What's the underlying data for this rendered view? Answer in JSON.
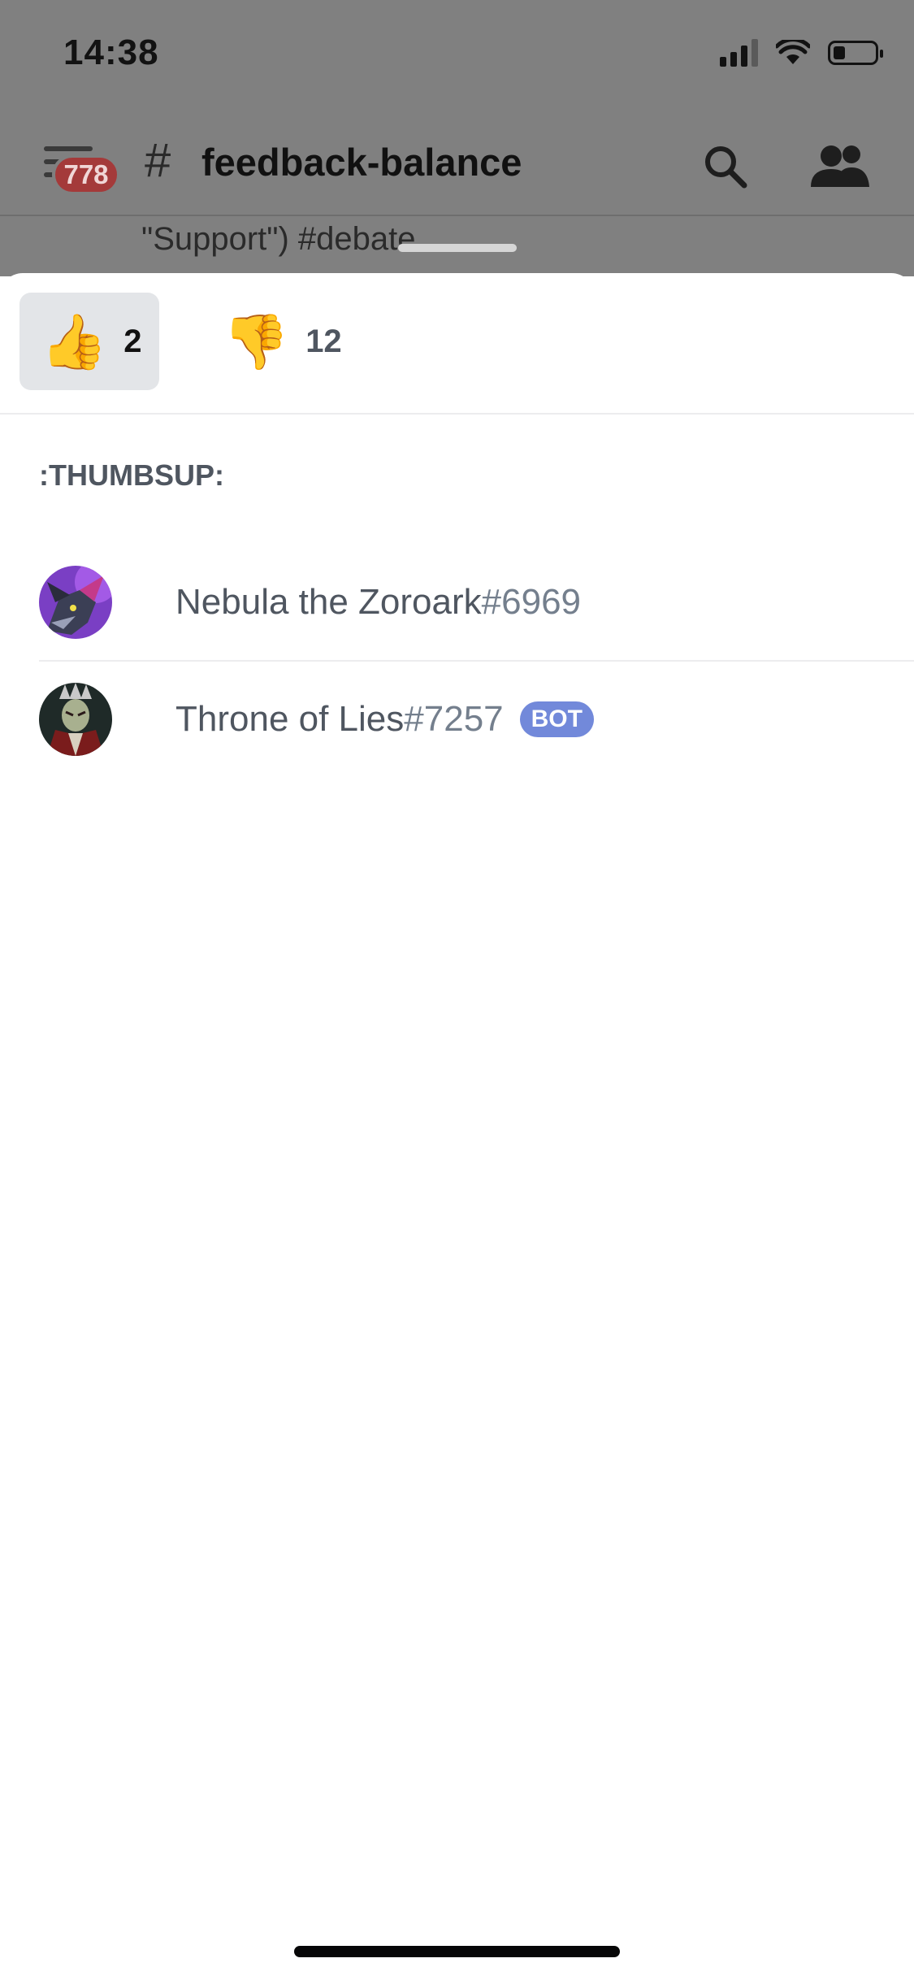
{
  "status_bar": {
    "time": "14:38"
  },
  "header": {
    "badge_count": "778",
    "hash_symbol": "#",
    "channel_name": "feedback-balance",
    "message_preview": "\"Support\") #debate"
  },
  "reactions_sheet": {
    "tabs": [
      {
        "emoji": "👍",
        "count": "2",
        "selected": true
      },
      {
        "emoji": "👎",
        "count": "12",
        "selected": false
      }
    ],
    "section_title": ":THUMBSUP:",
    "users": [
      {
        "name": "Nebula the Zoroark",
        "tag": "#6969",
        "bot": false
      },
      {
        "name": "Throne of Lies",
        "tag": "#7257",
        "bot": true,
        "bot_label": "BOT"
      }
    ]
  },
  "colors": {
    "overlay": "#808080",
    "badge": "#a43a3a",
    "bot_badge": "#7289da",
    "tab_selected_bg": "#e3e5e8",
    "text_muted": "#4f5660"
  }
}
